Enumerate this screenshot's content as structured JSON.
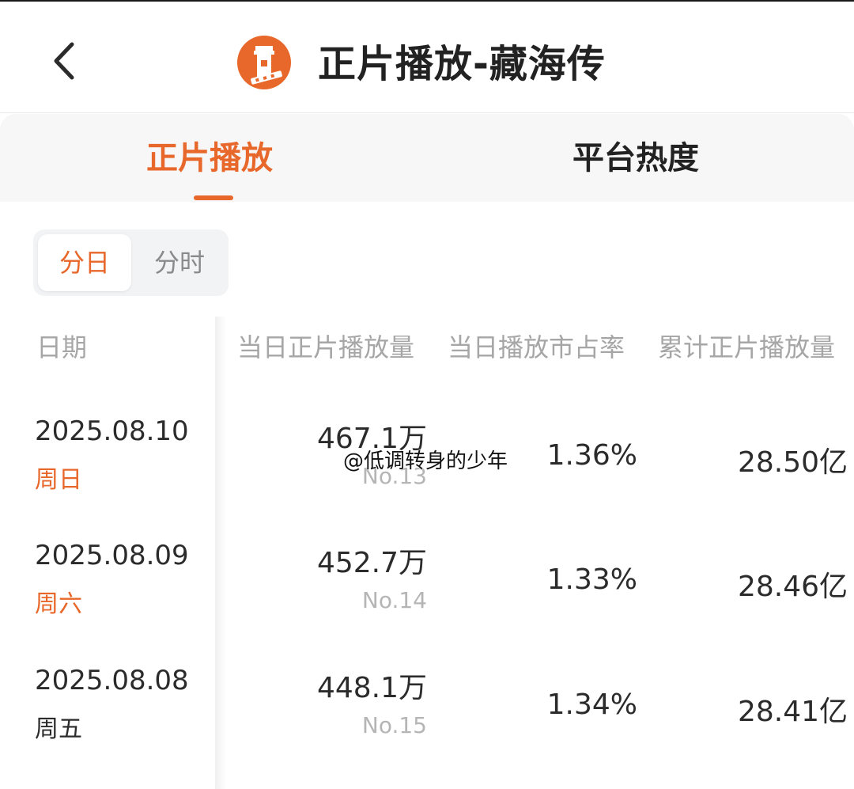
{
  "header": {
    "back_icon": "chevron-left-icon",
    "logo_icon": "tower-film-logo",
    "title": "正片播放-藏海传",
    "accent_color": "#e8672a"
  },
  "tabs": [
    {
      "label": "正片播放",
      "active": true
    },
    {
      "label": "平台热度",
      "active": false
    }
  ],
  "segment": {
    "options": [
      "分日",
      "分时"
    ],
    "selected": "分日"
  },
  "table": {
    "headers": {
      "date": "日期",
      "daily_plays": "当日正片播放量",
      "daily_share": "当日播放市占率",
      "total_plays": "累计正片播放量"
    },
    "rows": [
      {
        "date": "2025.08.10",
        "weekday": "周日",
        "daily_plays": "467.1万",
        "rank": "No.13",
        "daily_share": "1.36%",
        "total_plays": "28.50亿"
      },
      {
        "date": "2025.08.09",
        "weekday": "周六",
        "daily_plays": "452.7万",
        "rank": "No.14",
        "daily_share": "1.33%",
        "total_plays": "28.46亿"
      },
      {
        "date": "2025.08.08",
        "weekday": "周五",
        "daily_plays": "448.1万",
        "rank": "No.15",
        "daily_share": "1.34%",
        "total_plays": "28.41亿"
      }
    ]
  },
  "watermark": "@低调转身的少年"
}
